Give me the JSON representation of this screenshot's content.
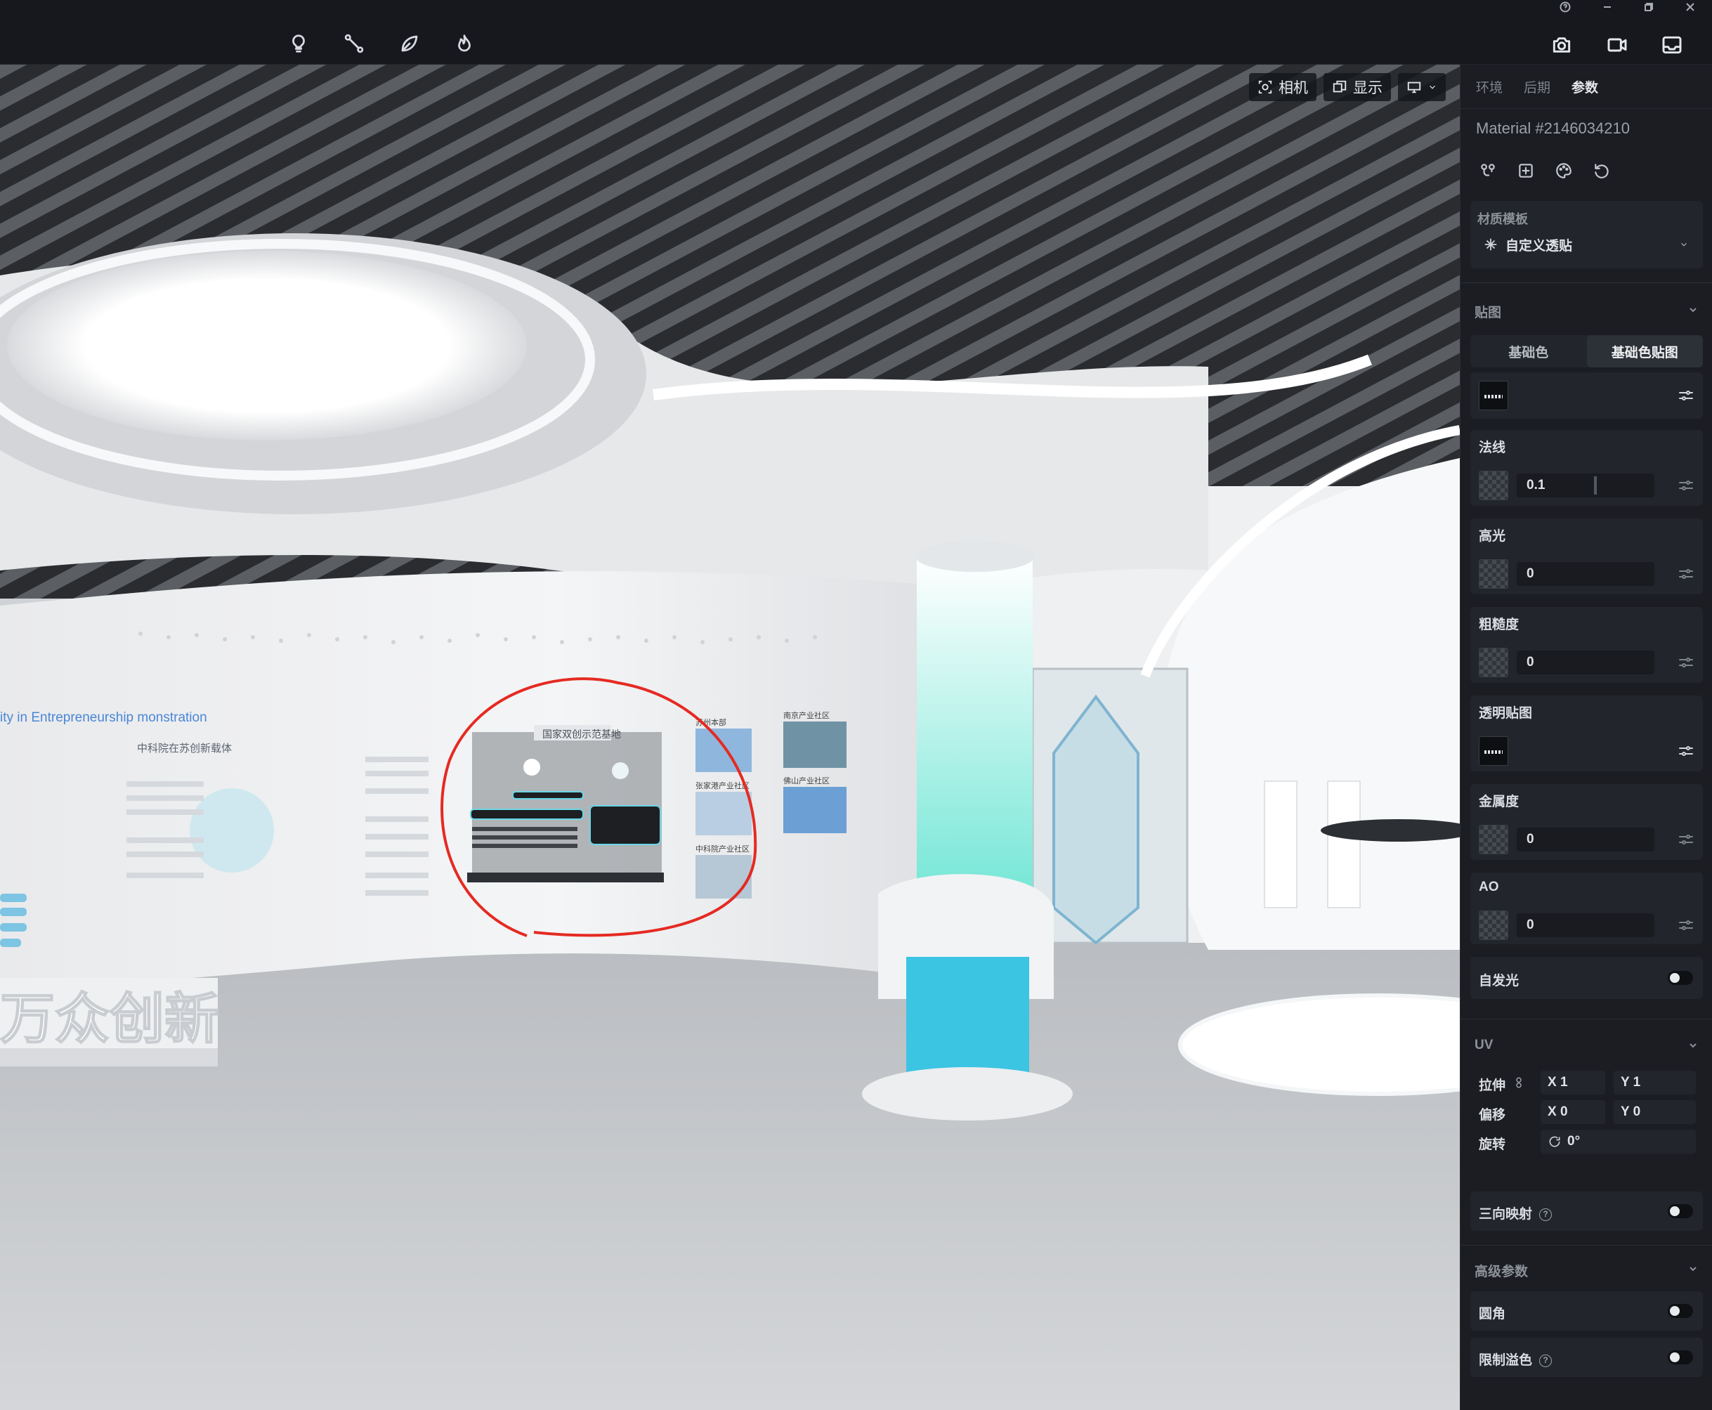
{
  "toolbar": {
    "tools": [
      "lightbulb-icon",
      "path-icon",
      "leaf-icon",
      "flame-icon"
    ],
    "capture": [
      "camera-icon",
      "video-icon",
      "inbox-icon"
    ],
    "window_controls": [
      "help-icon",
      "minimize-icon",
      "restore-icon",
      "close-icon"
    ]
  },
  "viewport": {
    "camera_label": "相机",
    "display_label": "显示",
    "scene": {
      "wall_title_1": "中科院在苏创新载体",
      "wall_title_2": "国家双创示范基地",
      "wall_en": "ity in Entrepreneurship monstration",
      "sign_text": "万众创新",
      "photo_1": "苏州本部",
      "photo_2": "南京产业社区",
      "photo_3": "张家港产业社区",
      "photo_4": "佛山产业社区",
      "photo_5": "中科院产业社区"
    },
    "annotation_color": "#e52a22"
  },
  "panel": {
    "tabs": [
      "环境",
      "后期",
      "参数"
    ],
    "active_tab": 2,
    "material_name": "Material #2146034210",
    "template": {
      "section_label": "材质模板",
      "value": "自定义透贴"
    },
    "maps": {
      "section_label": "贴图",
      "base_tabs": [
        "基础色",
        "基础色贴图"
      ],
      "active_base_tab": 1,
      "normal": {
        "label": "法线",
        "value": "0.1"
      },
      "specular": {
        "label": "高光",
        "value": "0"
      },
      "roughness": {
        "label": "粗糙度",
        "value": "0"
      },
      "opacity_map": {
        "label": "透明贴图"
      },
      "metalness": {
        "label": "金属度",
        "value": "0"
      },
      "ao": {
        "label": "AO",
        "value": "0"
      },
      "emissive": {
        "label": "自发光",
        "enabled": false
      }
    },
    "uv": {
      "section_label": "UV",
      "stretch_label": "拉伸",
      "stretch_x": "X 1",
      "stretch_y": "Y 1",
      "offset_label": "偏移",
      "offset_x": "X 0",
      "offset_y": "Y 0",
      "rotate_label": "旋转",
      "rotate_value": "0°",
      "triplanar_label": "三向映射",
      "triplanar_enabled": false
    },
    "advanced": {
      "section_label": "高级参数",
      "rounded_label": "圆角",
      "rounded_enabled": false,
      "limit_overflow_label": "限制溢色",
      "limit_overflow_enabled": false
    }
  }
}
